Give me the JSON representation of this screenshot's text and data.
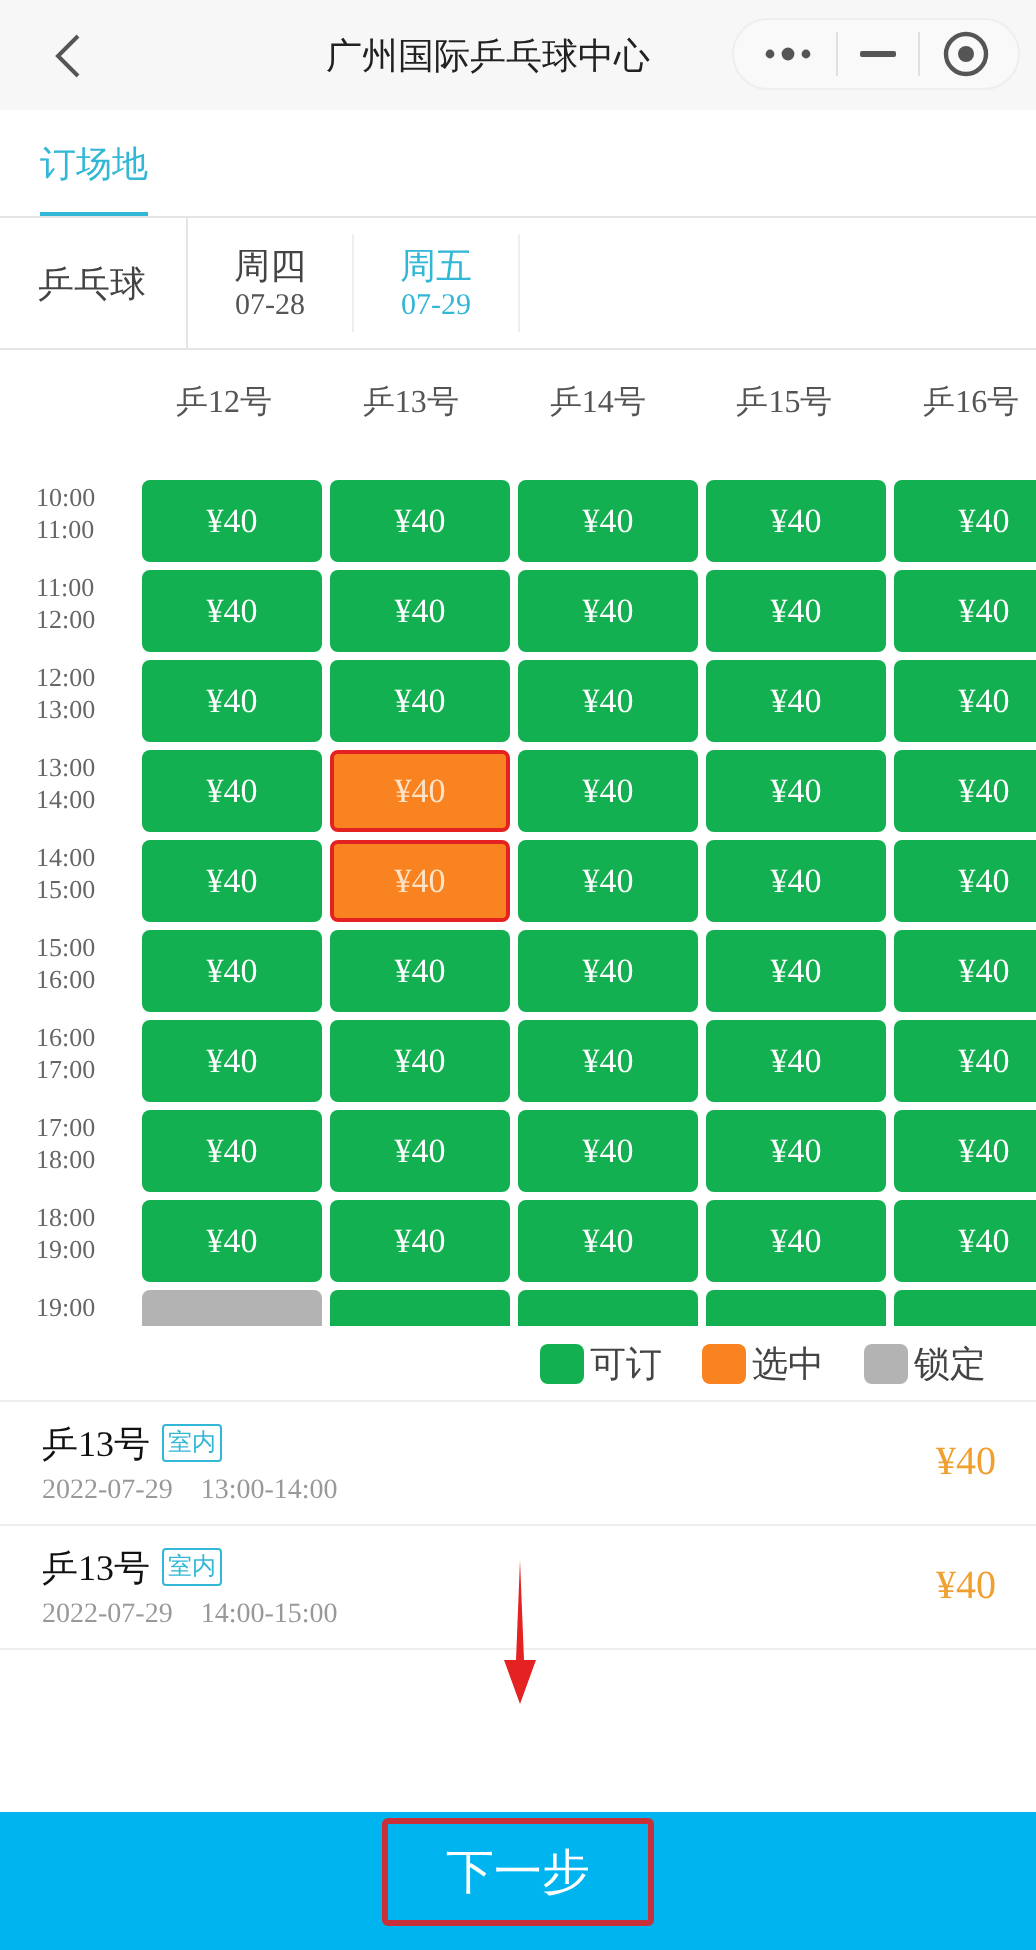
{
  "nav_bar": {
    "title": "广州国际乒乓球中心"
  },
  "tabs": [
    {
      "label": "订场地",
      "selected": true
    }
  ],
  "sport": "乒乓球",
  "dates": [
    {
      "weekday": "周四",
      "date": "07-28",
      "selected": false
    },
    {
      "weekday": "周五",
      "date": "07-29",
      "selected": true
    }
  ],
  "courts": [
    "乒12号",
    "乒13号",
    "乒14号",
    "乒15号",
    "乒16号"
  ],
  "slots": [
    {
      "start": "10:00",
      "end": "11:00",
      "cells": [
        {
          "selected": false,
          "locked": false,
          "price": "¥40"
        },
        {
          "selected": false,
          "locked": false,
          "price": "¥40"
        },
        {
          "selected": false,
          "locked": false,
          "price": "¥40"
        },
        {
          "selected": false,
          "locked": false,
          "price": "¥40"
        },
        {
          "selected": false,
          "locked": false,
          "price": "¥40"
        }
      ]
    },
    {
      "start": "11:00",
      "end": "12:00",
      "cells": [
        {
          "selected": false,
          "locked": false,
          "price": "¥40"
        },
        {
          "selected": false,
          "locked": false,
          "price": "¥40"
        },
        {
          "selected": false,
          "locked": false,
          "price": "¥40"
        },
        {
          "selected": false,
          "locked": false,
          "price": "¥40"
        },
        {
          "selected": false,
          "locked": false,
          "price": "¥40"
        }
      ]
    },
    {
      "start": "12:00",
      "end": "13:00",
      "cells": [
        {
          "selected": false,
          "locked": false,
          "price": "¥40"
        },
        {
          "selected": false,
          "locked": false,
          "price": "¥40"
        },
        {
          "selected": false,
          "locked": false,
          "price": "¥40"
        },
        {
          "selected": false,
          "locked": false,
          "price": "¥40"
        },
        {
          "selected": false,
          "locked": false,
          "price": "¥40"
        }
      ]
    },
    {
      "start": "13:00",
      "end": "14:00",
      "cells": [
        {
          "selected": false,
          "locked": false,
          "price": "¥40"
        },
        {
          "selected": true,
          "locked": false,
          "price": "¥40"
        },
        {
          "selected": false,
          "locked": false,
          "price": "¥40"
        },
        {
          "selected": false,
          "locked": false,
          "price": "¥40"
        },
        {
          "selected": false,
          "locked": false,
          "price": "¥40"
        }
      ]
    },
    {
      "start": "14:00",
      "end": "15:00",
      "cells": [
        {
          "selected": false,
          "locked": false,
          "price": "¥40"
        },
        {
          "selected": true,
          "locked": false,
          "price": "¥40"
        },
        {
          "selected": false,
          "locked": false,
          "price": "¥40"
        },
        {
          "selected": false,
          "locked": false,
          "price": "¥40"
        },
        {
          "selected": false,
          "locked": false,
          "price": "¥40"
        }
      ]
    },
    {
      "start": "15:00",
      "end": "16:00",
      "cells": [
        {
          "selected": false,
          "locked": false,
          "price": "¥40"
        },
        {
          "selected": false,
          "locked": false,
          "price": "¥40"
        },
        {
          "selected": false,
          "locked": false,
          "price": "¥40"
        },
        {
          "selected": false,
          "locked": false,
          "price": "¥40"
        },
        {
          "selected": false,
          "locked": false,
          "price": "¥40"
        }
      ]
    },
    {
      "start": "16:00",
      "end": "17:00",
      "cells": [
        {
          "selected": false,
          "locked": false,
          "price": "¥40"
        },
        {
          "selected": false,
          "locked": false,
          "price": "¥40"
        },
        {
          "selected": false,
          "locked": false,
          "price": "¥40"
        },
        {
          "selected": false,
          "locked": false,
          "price": "¥40"
        },
        {
          "selected": false,
          "locked": false,
          "price": "¥40"
        }
      ]
    },
    {
      "start": "17:00",
      "end": "18:00",
      "cells": [
        {
          "selected": false,
          "locked": false,
          "price": "¥40"
        },
        {
          "selected": false,
          "locked": false,
          "price": "¥40"
        },
        {
          "selected": false,
          "locked": false,
          "price": "¥40"
        },
        {
          "selected": false,
          "locked": false,
          "price": "¥40"
        },
        {
          "selected": false,
          "locked": false,
          "price": "¥40"
        }
      ]
    },
    {
      "start": "18:00",
      "end": "19:00",
      "cells": [
        {
          "selected": false,
          "locked": false,
          "price": "¥40"
        },
        {
          "selected": false,
          "locked": false,
          "price": "¥40"
        },
        {
          "selected": false,
          "locked": false,
          "price": "¥40"
        },
        {
          "selected": false,
          "locked": false,
          "price": "¥40"
        },
        {
          "selected": false,
          "locked": false,
          "price": "¥40"
        }
      ]
    },
    {
      "start": "19:00",
      "cells": [
        {
          "selected": false,
          "locked": true
        },
        {
          "selected": false,
          "locked": false
        },
        {
          "selected": false,
          "locked": false
        },
        {
          "selected": false,
          "locked": false
        },
        {
          "selected": false,
          "locked": false
        }
      ]
    }
  ],
  "legend": [
    {
      "label": "可订",
      "color": "#12b050"
    },
    {
      "label": "选中",
      "color": "#f98320"
    },
    {
      "label": "锁定",
      "color": "#b3b3b3"
    }
  ],
  "bookings": [
    {
      "court": "乒13号",
      "tag": "室内",
      "date": "2022-07-29",
      "time": "13:00-14:00",
      "price": "¥40"
    },
    {
      "court": "乒13号",
      "tag": "室内",
      "date": "2022-07-29",
      "time": "14:00-15:00",
      "price": "¥40"
    }
  ],
  "next_button": "下一步"
}
